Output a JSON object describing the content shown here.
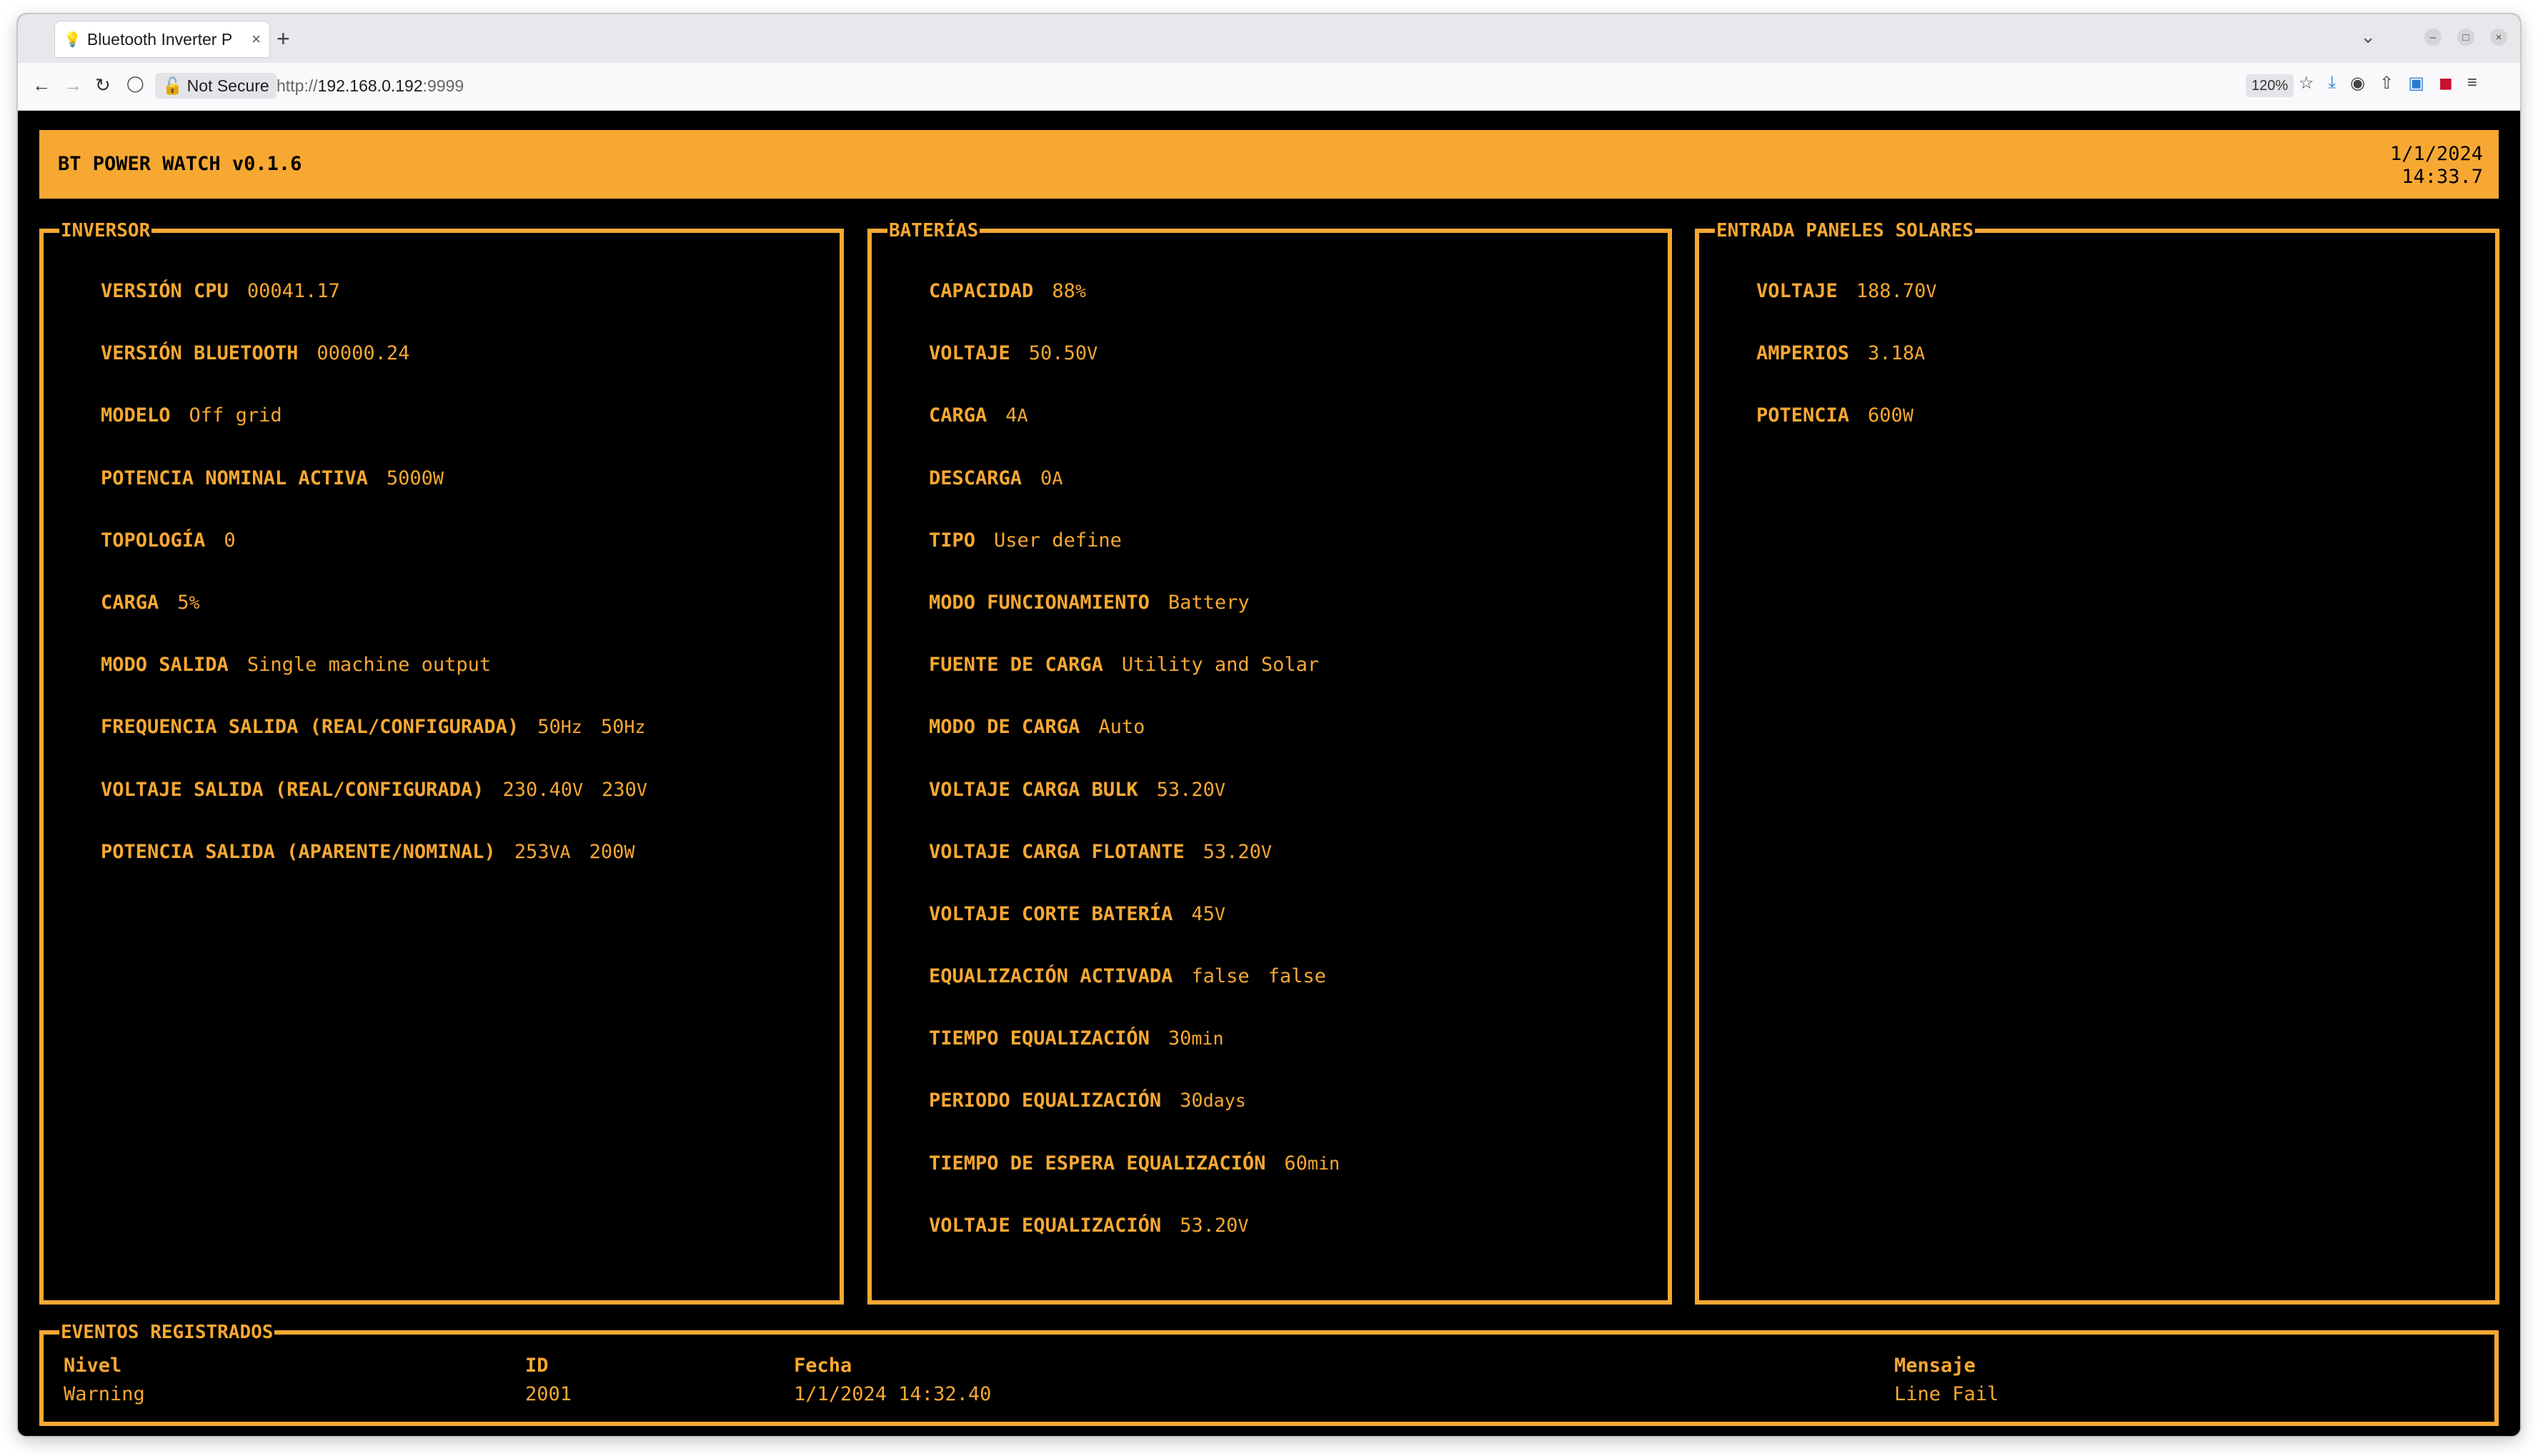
{
  "browser": {
    "tab_title": "Bluetooth Inverter P",
    "new_tab": "+",
    "security_label": "Not Secure",
    "url_prefix": "http://",
    "url_host": "192.168.0.192",
    "url_port": ":9999",
    "zoom": "120%",
    "icons": [
      "back-arrow-icon",
      "forward-arrow-icon",
      "reload-icon",
      "shield-icon",
      "star-icon",
      "download-icon",
      "extension-icon",
      "share-icon",
      "bitwarden-icon",
      "ublock-icon",
      "menu-icon"
    ]
  },
  "app": {
    "title": "BT POWER WATCH v0.1.6",
    "date": "1/1/2024",
    "time": "14:33.7",
    "accent_color": "#f7a833",
    "background_color": "#000000"
  },
  "inversor": {
    "title": "INVERSOR",
    "rows": [
      {
        "label": "VERSIÓN CPU",
        "values": [
          {
            "v": "00041.17",
            "u": ""
          }
        ]
      },
      {
        "label": "VERSIÓN BLUETOOTH",
        "values": [
          {
            "v": "00000.24",
            "u": ""
          }
        ]
      },
      {
        "label": "MODELO",
        "values": [
          {
            "v": "Off grid",
            "u": ""
          }
        ]
      },
      {
        "label": "POTENCIA NOMINAL ACTIVA",
        "values": [
          {
            "v": "5000",
            "u": "W"
          }
        ]
      },
      {
        "label": "TOPOLOGÍA",
        "values": [
          {
            "v": "0",
            "u": ""
          }
        ]
      },
      {
        "label": "CARGA",
        "values": [
          {
            "v": "5",
            "u": "%"
          }
        ]
      },
      {
        "label": "MODO SALIDA",
        "values": [
          {
            "v": "Single machine output",
            "u": ""
          }
        ]
      },
      {
        "label": "FREQUENCIA SALIDA (REAL/CONFIGURADA)",
        "values": [
          {
            "v": "50",
            "u": "Hz"
          },
          {
            "v": "50",
            "u": "Hz"
          }
        ]
      },
      {
        "label": "VOLTAJE SALIDA (REAL/CONFIGURADA)",
        "values": [
          {
            "v": "230.40",
            "u": "V"
          },
          {
            "v": "230",
            "u": "V"
          }
        ]
      },
      {
        "label": "POTENCIA SALIDA (APARENTE/NOMINAL)",
        "values": [
          {
            "v": "253",
            "u": "VA"
          },
          {
            "v": "200",
            "u": "W"
          }
        ]
      }
    ]
  },
  "baterias": {
    "title": "BATERÍAS",
    "rows": [
      {
        "label": "CAPACIDAD",
        "values": [
          {
            "v": "88",
            "u": "%"
          }
        ]
      },
      {
        "label": "VOLTAJE",
        "values": [
          {
            "v": "50.50",
            "u": "V"
          }
        ]
      },
      {
        "label": "CARGA",
        "values": [
          {
            "v": "4",
            "u": "A"
          }
        ]
      },
      {
        "label": "DESCARGA",
        "values": [
          {
            "v": "0",
            "u": "A"
          }
        ]
      },
      {
        "label": "TIPO",
        "values": [
          {
            "v": "User define",
            "u": ""
          }
        ]
      },
      {
        "label": "MODO FUNCIONAMIENTO",
        "values": [
          {
            "v": "Battery",
            "u": ""
          }
        ]
      },
      {
        "label": "FUENTE DE CARGA",
        "values": [
          {
            "v": "Utility and Solar",
            "u": ""
          }
        ]
      },
      {
        "label": "MODO DE CARGA",
        "values": [
          {
            "v": "Auto",
            "u": ""
          }
        ]
      },
      {
        "label": "VOLTAJE CARGA BULK",
        "values": [
          {
            "v": "53.20",
            "u": "V"
          }
        ]
      },
      {
        "label": "VOLTAJE CARGA FLOTANTE",
        "values": [
          {
            "v": "53.20",
            "u": "V"
          }
        ]
      },
      {
        "label": "VOLTAJE CORTE BATERÍA",
        "values": [
          {
            "v": "45",
            "u": "V"
          }
        ]
      },
      {
        "label": "EQUALIZACIÓN ACTIVADA",
        "values": [
          {
            "v": "false",
            "u": ""
          },
          {
            "v": "false",
            "u": ""
          }
        ]
      },
      {
        "label": "TIEMPO EQUALIZACIÓN",
        "values": [
          {
            "v": "30",
            "u": "min"
          }
        ]
      },
      {
        "label": "PERIODO EQUALIZACIÓN",
        "values": [
          {
            "v": "30",
            "u": "days"
          }
        ]
      },
      {
        "label": "TIEMPO DE ESPERA EQUALIZACIÓN",
        "values": [
          {
            "v": "60",
            "u": "min"
          }
        ]
      },
      {
        "label": "VOLTAJE EQUALIZACIÓN",
        "values": [
          {
            "v": "53.20",
            "u": "V"
          }
        ]
      }
    ]
  },
  "solar": {
    "title": "ENTRADA PANELES SOLARES",
    "rows": [
      {
        "label": "VOLTAJE",
        "values": [
          {
            "v": "188.70",
            "u": "V"
          }
        ]
      },
      {
        "label": "AMPERIOS",
        "values": [
          {
            "v": "3.18",
            "u": "A"
          }
        ]
      },
      {
        "label": "POTENCIA",
        "values": [
          {
            "v": "600",
            "u": "W"
          }
        ]
      }
    ]
  },
  "eventos": {
    "title": "EVENTOS REGISTRADOS",
    "headers": {
      "nivel": "Nivel",
      "id": "ID",
      "fecha": "Fecha",
      "mensaje": "Mensaje"
    },
    "rows": [
      {
        "nivel": "Warning",
        "id": "2001",
        "fecha": "1/1/2024 14:32.40",
        "mensaje": "Line Fail"
      }
    ]
  }
}
